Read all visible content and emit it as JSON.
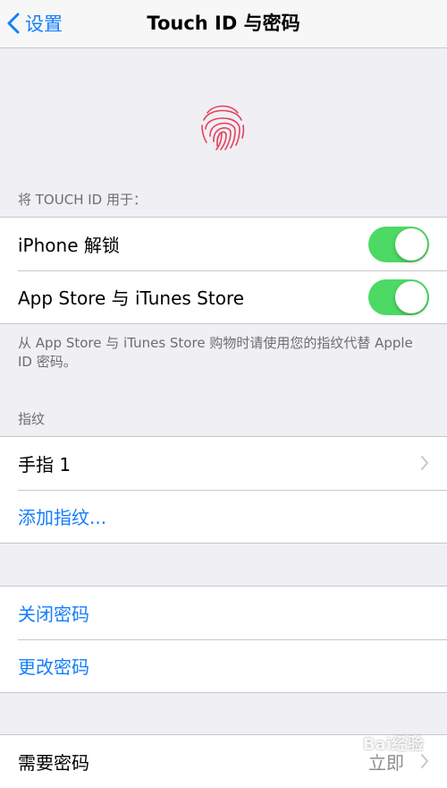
{
  "nav": {
    "back_label": "设置",
    "title": "Touch ID 与密码"
  },
  "touch_section": {
    "header": "将 TOUCH ID 用于：",
    "rows": [
      {
        "label": "iPhone 解锁",
        "toggle": true
      },
      {
        "label": "App Store 与 iTunes Store",
        "toggle": true
      }
    ],
    "footer": "从 App Store 与 iTunes Store 购物时请使用您的指纹代替 Apple ID 密码。"
  },
  "fingerprint_section": {
    "header": "指纹",
    "finger1": "手指 1",
    "add": "添加指纹..."
  },
  "passcode_section": {
    "turn_off": "关闭密码",
    "change": "更改密码"
  },
  "require_section": {
    "label": "需要密码",
    "value": "立即"
  },
  "watermark": "Bai经验",
  "colors": {
    "accent": "#147efb",
    "toggle_on": "#4cd964",
    "fingerprint": "#e8405a"
  }
}
